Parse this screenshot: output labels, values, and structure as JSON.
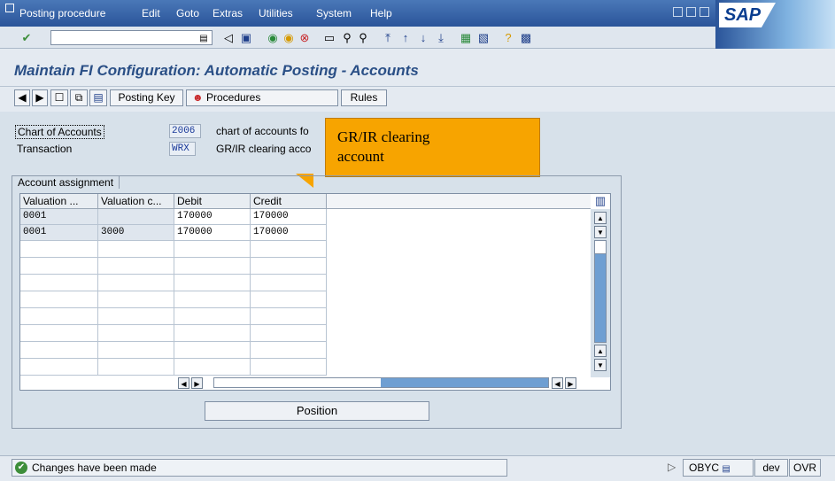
{
  "menubar": {
    "items": [
      "Posting procedure",
      "Edit",
      "Goto",
      "Extras",
      "Utilities",
      "System",
      "Help"
    ],
    "logo": "SAP"
  },
  "toolbar": {
    "command_field_value": ""
  },
  "header": {
    "title": "Maintain FI Configuration: Automatic Posting - Accounts"
  },
  "app_toolbar": {
    "posting_key_label": "Posting Key",
    "procedures_label": "Procedures",
    "rules_label": "Rules"
  },
  "fields": {
    "chart_label": "Chart of Accounts",
    "chart_value": "2006",
    "chart_desc": "chart of accounts fo",
    "transaction_label": "Transaction",
    "transaction_value": "WRX",
    "transaction_desc": "GR/IR clearing acco"
  },
  "callout": {
    "line1": "GR/IR clearing",
    "line2": "account"
  },
  "account_assignment": {
    "frame_title": "Account assignment",
    "columns": [
      "Valuation ...",
      "Valuation c...",
      "Debit",
      "Credit"
    ],
    "rows": [
      [
        "0001",
        "",
        "170000",
        "170000"
      ],
      [
        "0001",
        "3000",
        "170000",
        "170000"
      ]
    ]
  },
  "position_label": "Position",
  "statusbar": {
    "message": "Changes have been made",
    "transaction": "OBYC",
    "system": "dev",
    "mode": "OVR"
  },
  "colors": {
    "title": "#2a4f86",
    "callout": "#f7a400",
    "menubar": "#2a5499"
  }
}
